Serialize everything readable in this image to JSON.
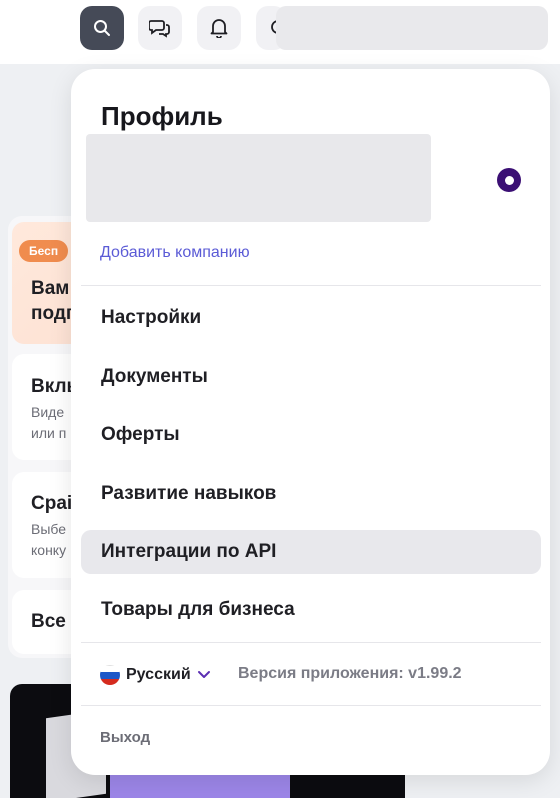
{
  "header": {
    "icons": [
      "search-icon",
      "chat-icon",
      "bell-icon",
      "support-icon"
    ]
  },
  "background": {
    "badge": "Бесп",
    "cards": [
      {
        "title": "Вам",
        "subtitle_line2": "подг"
      },
      {
        "title": "Вкль",
        "sub1": "Виде",
        "sub2": "или п"
      },
      {
        "title": "Сраі",
        "sub1": "Выбе",
        "sub2": "конку"
      },
      {
        "title": "Все і"
      }
    ]
  },
  "profile_menu": {
    "title": "Профиль",
    "add_company": "Добавить компанию",
    "items": [
      {
        "label": "Настройки"
      },
      {
        "label": "Документы"
      },
      {
        "label": "Оферты"
      },
      {
        "label": "Развитие навыков"
      },
      {
        "label": "Интеграции по API"
      },
      {
        "label": "Товары для бизнеса"
      }
    ],
    "highlighted_item": "Интеграции по API",
    "language": "Русский",
    "version": "Версия приложения: v1.99.2",
    "logout": "Выход"
  },
  "colors": {
    "accent": "#5b5bd6",
    "radio": "#3b0f74",
    "active_icon_bg": "#454a57"
  }
}
